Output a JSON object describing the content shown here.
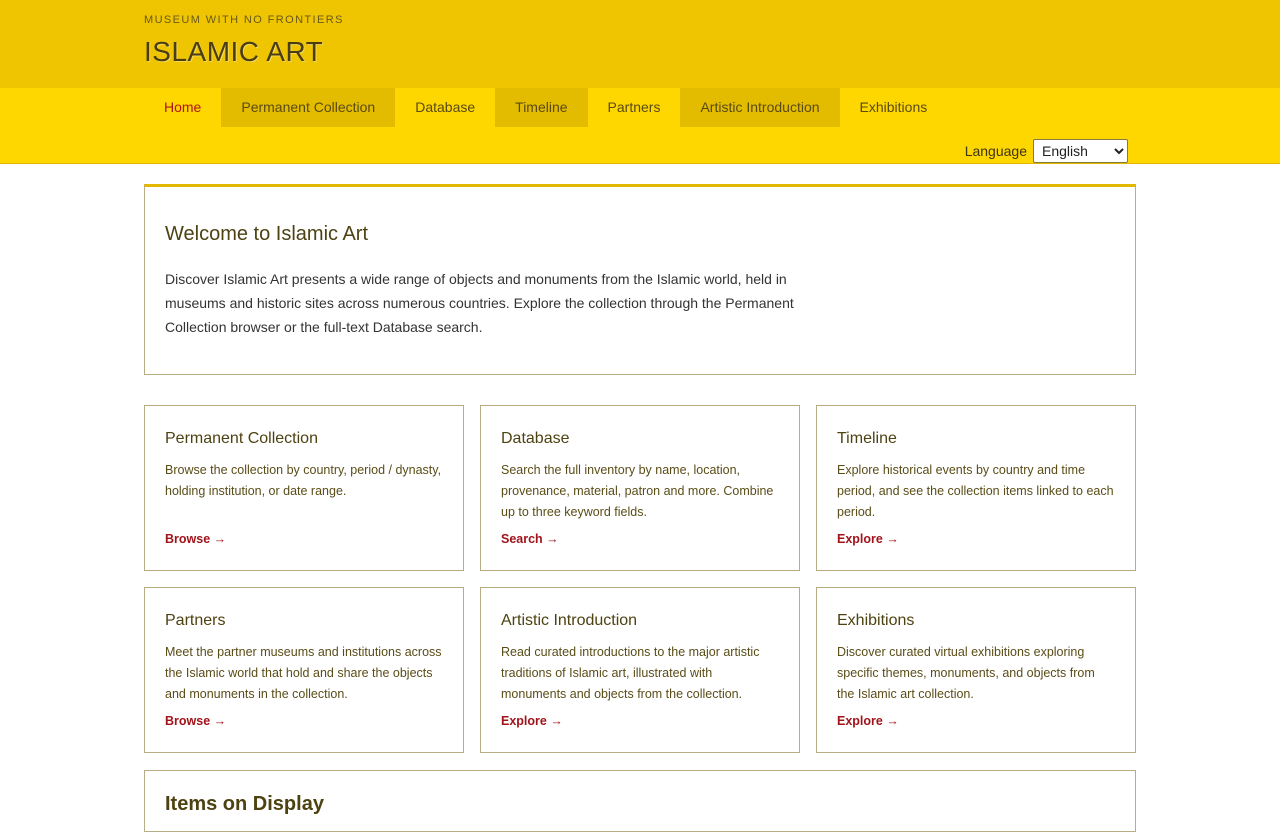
{
  "header": {
    "tagline": "MUSEUM WITH NO FRONTIERS",
    "title": "ISLAMIC ART"
  },
  "nav": {
    "items": [
      {
        "label": "Home",
        "active": true
      },
      {
        "label": "Permanent Collection"
      },
      {
        "label": "Database"
      },
      {
        "label": "Timeline"
      },
      {
        "label": "Partners"
      },
      {
        "label": "Artistic Introduction"
      },
      {
        "label": "Exhibitions"
      }
    ]
  },
  "language": {
    "label": "Language",
    "selected": "English"
  },
  "welcome": {
    "title": "Welcome to Islamic Art",
    "text": "Discover Islamic Art presents a wide range of objects and monuments from the Islamic world, held in museums and historic sites across numerous countries. Explore the collection through the Permanent Collection browser or the full-text Database search."
  },
  "cards": [
    {
      "title": "Permanent Collection",
      "text": "Browse the collection by country, period / dynasty, holding institution, or date range.",
      "link": "Browse →"
    },
    {
      "title": "Database",
      "text": "Search the full inventory by name, location, provenance, material, patron and more. Combine up to three keyword fields.",
      "link": "Search →"
    },
    {
      "title": "Timeline",
      "text": "Explore historical events by country and time period, and see the collection items linked to each period.",
      "link": "Explore →"
    },
    {
      "title": "Partners",
      "text": "Meet the partner museums and institutions across the Islamic world that hold and share the objects and monuments in the collection.",
      "link": "Browse →"
    },
    {
      "title": "Artistic Introduction",
      "text": "Read curated introductions to the major artistic traditions of Islamic art, illustrated with monuments and objects from the collection.",
      "link": "Explore →"
    },
    {
      "title": "Exhibitions",
      "text": "Discover curated virtual exhibitions exploring specific themes, monuments, and objects from the Islamic art collection.",
      "link": "Explore →"
    }
  ],
  "bottom_section": {
    "title": "Items on Display"
  },
  "colors": {
    "header_top": "#efc400",
    "nav_bar": "#ffd700",
    "accent_link": "#a0141a",
    "heading": "#4d4211"
  }
}
